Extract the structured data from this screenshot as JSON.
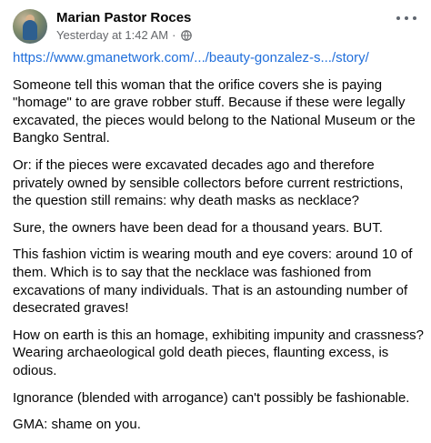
{
  "post": {
    "author": "Marian Pastor Roces",
    "timestamp": "Yesterday at 1:42 AM",
    "separator": "·",
    "privacy_icon": "globe-icon",
    "more_icon": "more-options-icon",
    "link": "https://www.gmanetwork.com/.../beauty-gonzalez-s.../story/",
    "paragraphs": [
      "Someone tell this woman that the orifice covers she is paying \"homage\" to are grave robber stuff. Because if these were legally excavated, the pieces would belong to the National Museum or the Bangko Sentral.",
      "Or: if the pieces were excavated decades ago and therefore privately owned by sensible collectors before current restrictions, the question still remains: why death masks as necklace?",
      "Sure, the owners have been dead for a thousand years. BUT.",
      "This fashion victim is wearing mouth and eye covers: around 10 of them. Which is to say that the necklace was fashioned from excavations of many individuals. That is an astounding number of desecrated graves!",
      "How on earth is this an homage, exhibiting impunity and crassness? Wearing archaeological gold death pieces, flaunting excess, is odious.",
      "Ignorance (blended with arrogance) can't possibly be fashionable.",
      "GMA: shame on you."
    ]
  },
  "colors": {
    "link": "#216fdb",
    "meta_text": "#65676b",
    "body_text": "#050505"
  }
}
